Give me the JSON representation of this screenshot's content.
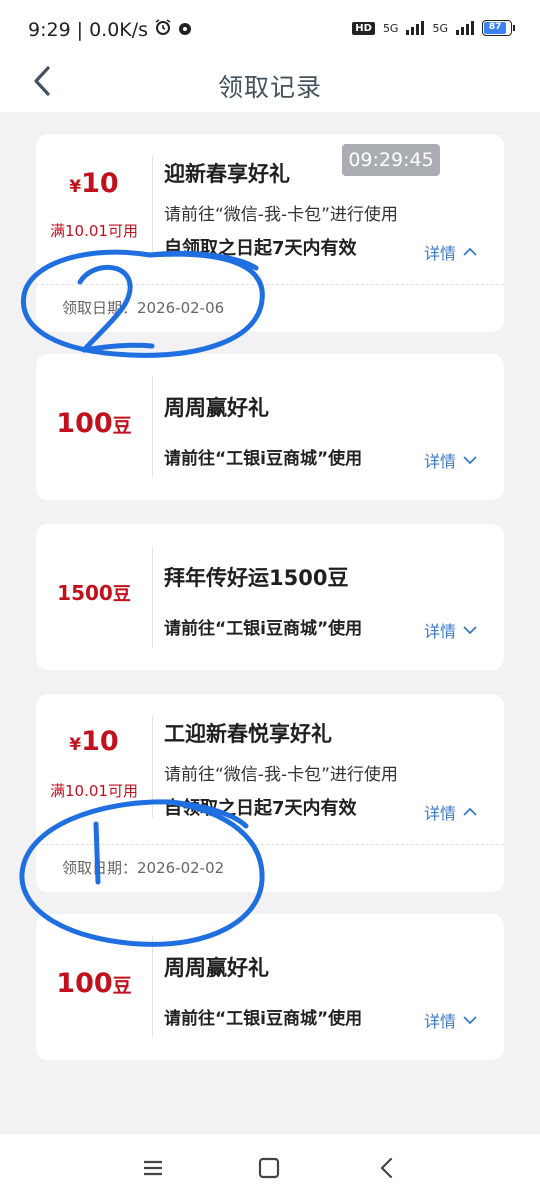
{
  "status_bar": {
    "time": "9:29",
    "net_speed": "0.0K/s",
    "hd_label": "HD",
    "signal1": "5G",
    "signal2": "5G",
    "battery": "87"
  },
  "header": {
    "title": "领取记录"
  },
  "time_badge": "09:29:45",
  "cards": [
    {
      "currency": "¥",
      "amount": "10",
      "unit": "",
      "condition": "满10.01可用",
      "title": "迎新春享好礼",
      "desc": "请前往“微信-我-卡包”进行使用",
      "validity": "自领取之日起7天内有效",
      "detail": "详情",
      "claim_date": "领取日期：2026-02-06"
    },
    {
      "currency": "",
      "amount": "100",
      "unit": "豆",
      "title": "周周赢好礼",
      "desc": "请前往“工银i豆商城”使用",
      "detail": "详情"
    },
    {
      "currency": "",
      "amount": "1500",
      "unit": "豆",
      "title": "拜年传好运1500豆",
      "desc": "请前往“工银i豆商城”使用",
      "detail": "详情"
    },
    {
      "currency": "¥",
      "amount": "10",
      "unit": "",
      "condition": "满10.01可用",
      "title": "工迎新春悦享好礼",
      "desc": "请前往“微信-我-卡包”进行使用",
      "validity": "自领取之日起7天内有效",
      "detail": "详情",
      "claim_date": "领取日期：2026-02-02"
    },
    {
      "currency": "",
      "amount": "100",
      "unit": "豆",
      "title": "周周赢好礼",
      "desc": "请前往“工银i豆商城”使用",
      "detail": "详情"
    }
  ],
  "colors": {
    "accent": "#3a78c9",
    "price": "#c0111d",
    "annotation": "#1f6fe0"
  }
}
